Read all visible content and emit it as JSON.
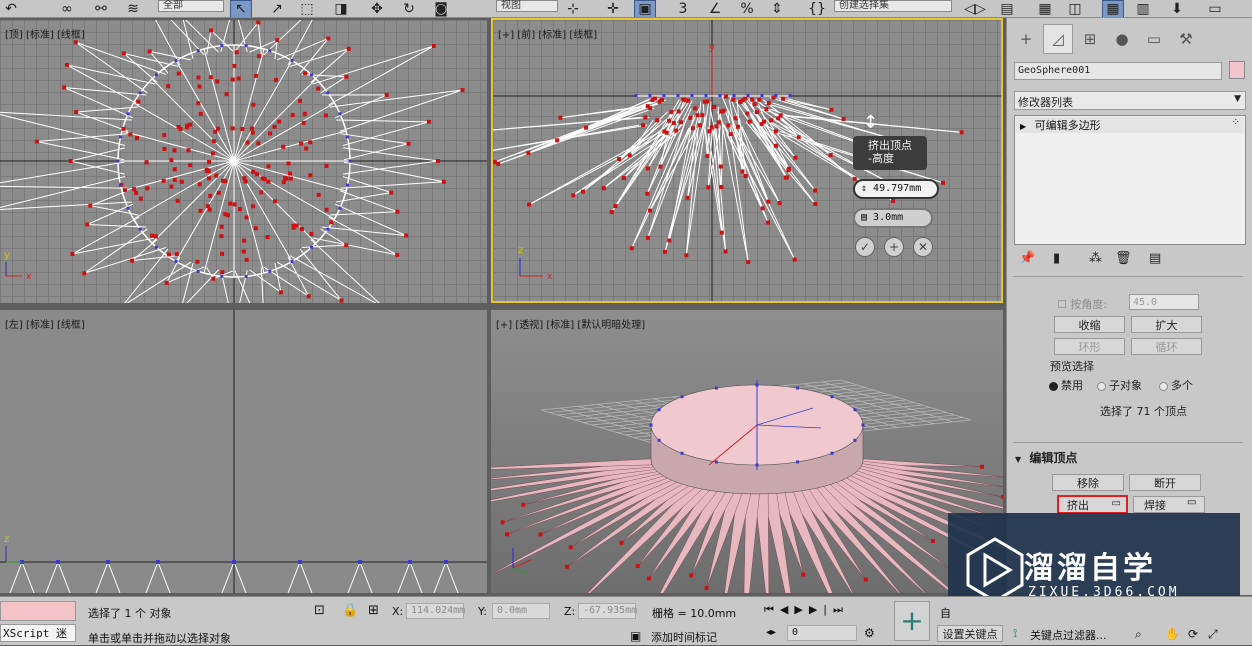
{
  "toolbar": {
    "filter_value": "全部",
    "view_value": "视图",
    "selection_set_value": "创建选择集"
  },
  "viewports": {
    "top": {
      "label": "[顶] [标准] [线框]"
    },
    "front": {
      "label": "[+] [前] [标准] [线框]"
    },
    "left": {
      "label": "[左] [标准] [线框]"
    },
    "perspective": {
      "label": "[+] [透视] [标准] [默认明暗处理]"
    }
  },
  "caddy": {
    "title_line1": "挤出顶点",
    "title_line2": "-高度",
    "height_value": "49.797mm",
    "width_value": "3.0mm",
    "ok_icon": "check-icon",
    "apply_icon": "plus-icon",
    "cancel_icon": "x-icon"
  },
  "panel": {
    "object_name": "GeoSphere001",
    "object_color": "#f2c4cc",
    "modifier_list_label": "修改器列表",
    "stack_item": "可编辑多边形",
    "angle_label": "按角度:",
    "angle_value": "45.0",
    "shrink_label": "收缩",
    "grow_label": "扩大",
    "ring_label": "环形",
    "loop_label": "循环",
    "preview_label": "预览选择",
    "preview_options": [
      "禁用",
      "子对象",
      "多个"
    ],
    "selection_info": "选择了 71 个顶点",
    "edit_vertices_title": "编辑顶点",
    "remove_label": "移除",
    "break_label": "断开",
    "extrude_label": "挤出",
    "weld_label": "焊接"
  },
  "status": {
    "script_label": "XScript 迷",
    "selected_text": "选择了 1 个 对象",
    "prompt_text": "单击或单击并拖动以选择对象",
    "x_label": "X:",
    "x_value": "114.024mm",
    "y_label": "Y:",
    "y_value": "0.0mm",
    "z_label": "Z:",
    "z_value": "-67.935mm",
    "grid_text": "栅格 = 10.0mm",
    "add_time_tag": "添加时间标记",
    "frame_value": "0",
    "auto_label": "自",
    "set_key_label": "设置关键点",
    "key_filter_label": "关键点过滤器..."
  },
  "watermark": {
    "brand_cn": "溜溜自学",
    "brand_url": "ZIXUE.3D66.COM"
  },
  "colors": {
    "active_viewport_border": "#e9c536",
    "highlight_red": "#e02020",
    "vertex_red": "#d01010"
  }
}
